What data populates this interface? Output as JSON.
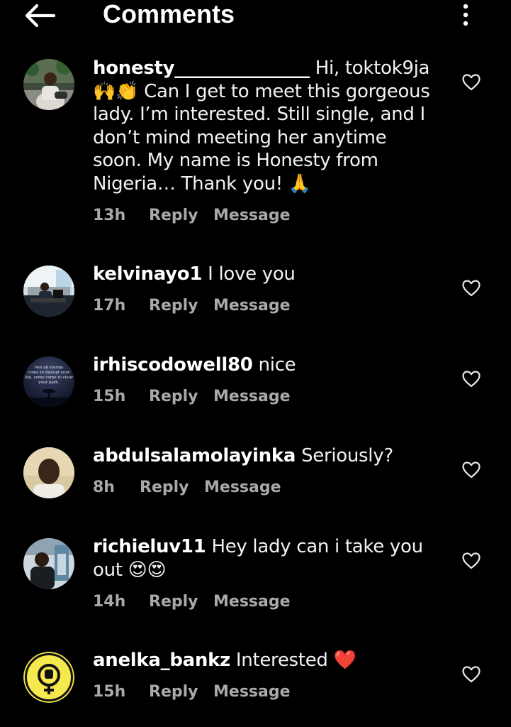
{
  "header": {
    "title": "Comments",
    "back_icon": "arrow-left-icon",
    "more_icon": "more-vertical-icon"
  },
  "colors": {
    "background": "#000000",
    "text": "#f2f2f2",
    "meta": "#a9a9a9",
    "heart_emoji": "#e0202a"
  },
  "comments": [
    {
      "username": "honesty_______________",
      "text": "Hi, toktok9ja",
      "text_2": "Can I get to meet this gorgeous lady. I’m interested. Still single, and I don’t mind meeting her anytime soon. My name is Honesty from Nigeria… Thank you!",
      "emoji_1": "🙌",
      "emoji_2": "👏",
      "emoji_3": "🙏",
      "time": "13h",
      "reply": "Reply",
      "message": "Message"
    },
    {
      "username": "kelvinayo1",
      "text": "I love you",
      "time": "17h",
      "reply": "Reply",
      "message": "Message"
    },
    {
      "username": "irhiscodowell80",
      "text": "nice",
      "time": "15h",
      "reply": "Reply",
      "message": "Message",
      "avatar_text": "Not all storms come to disrupt your life, some come to clear your path."
    },
    {
      "username": "abdulsalamolayinka",
      "text": "Seriously?",
      "time": "8h",
      "reply": "Reply",
      "message": "Message"
    },
    {
      "username": "richieluv11",
      "text": "Hey lady can i take you out",
      "emoji_1": "😍",
      "emoji_2": "😍",
      "time": "14h",
      "reply": "Reply",
      "message": "Message"
    },
    {
      "username": "anelka_bankz",
      "text": "Interested",
      "emoji_1": "❤️",
      "time": "15h",
      "reply": "Reply",
      "message": "Message"
    }
  ]
}
